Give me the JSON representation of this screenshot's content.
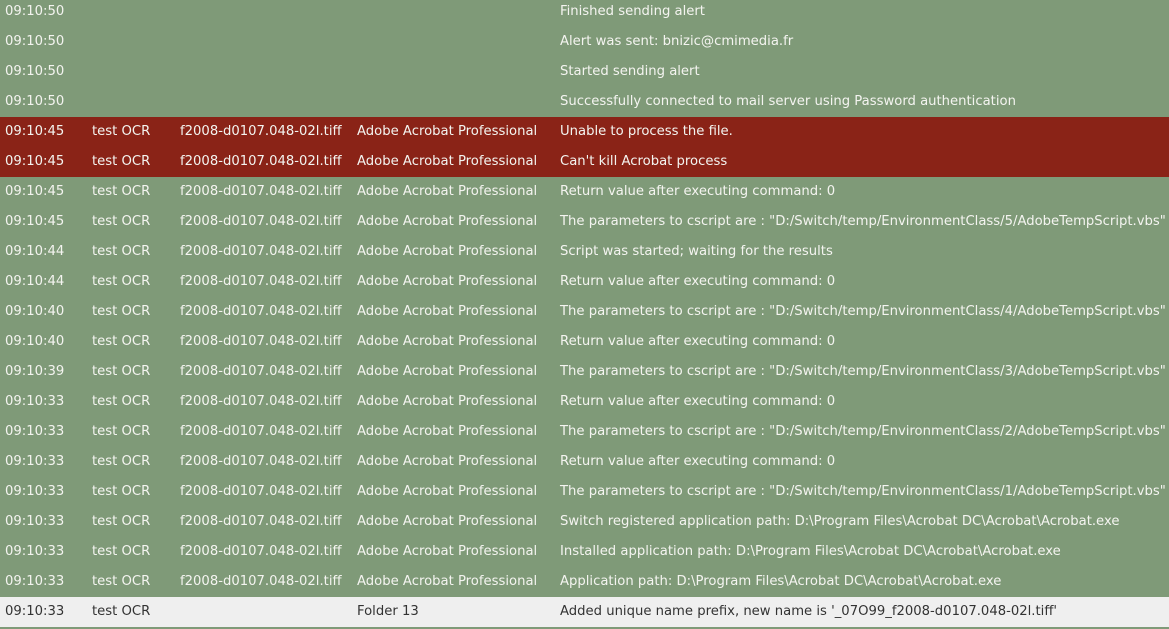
{
  "colors": {
    "info": "#7f9a78",
    "error": "#8a2317",
    "light": "#efefef"
  },
  "rows": [
    {
      "type": "info",
      "time": "09:10:50",
      "flow": "",
      "job": "",
      "element": "",
      "message": "Finished sending alert"
    },
    {
      "type": "info",
      "time": "09:10:50",
      "flow": "",
      "job": "",
      "element": "",
      "message": "Alert was sent: bnizic@cmimedia.fr"
    },
    {
      "type": "info",
      "time": "09:10:50",
      "flow": "",
      "job": "",
      "element": "",
      "message": "Started sending alert"
    },
    {
      "type": "info",
      "time": "09:10:50",
      "flow": "",
      "job": "",
      "element": "",
      "message": "Successfully connected to mail server using Password authentication"
    },
    {
      "type": "error",
      "time": "09:10:45",
      "flow": "test OCR",
      "job": "f2008-d0107.048-02l.tiff",
      "element": "Adobe Acrobat Professional",
      "message": "Unable to process the file."
    },
    {
      "type": "error",
      "time": "09:10:45",
      "flow": "test OCR",
      "job": "f2008-d0107.048-02l.tiff",
      "element": "Adobe Acrobat Professional",
      "message": "Can't kill Acrobat process"
    },
    {
      "type": "info",
      "time": "09:10:45",
      "flow": "test OCR",
      "job": "f2008-d0107.048-02l.tiff",
      "element": "Adobe Acrobat Professional",
      "message": "Return value after executing command: 0"
    },
    {
      "type": "info",
      "time": "09:10:45",
      "flow": "test OCR",
      "job": "f2008-d0107.048-02l.tiff",
      "element": "Adobe Acrobat Professional",
      "message": "The parameters to cscript are : \"D:/Switch/temp/EnvironmentClass/5/AdobeTempScript.vbs\""
    },
    {
      "type": "info",
      "time": "09:10:44",
      "flow": "test OCR",
      "job": "f2008-d0107.048-02l.tiff",
      "element": "Adobe Acrobat Professional",
      "message": "Script was started; waiting for the results"
    },
    {
      "type": "info",
      "time": "09:10:44",
      "flow": "test OCR",
      "job": "f2008-d0107.048-02l.tiff",
      "element": "Adobe Acrobat Professional",
      "message": "Return value after executing command: 0"
    },
    {
      "type": "info",
      "time": "09:10:40",
      "flow": "test OCR",
      "job": "f2008-d0107.048-02l.tiff",
      "element": "Adobe Acrobat Professional",
      "message": "The parameters to cscript are : \"D:/Switch/temp/EnvironmentClass/4/AdobeTempScript.vbs\""
    },
    {
      "type": "info",
      "time": "09:10:40",
      "flow": "test OCR",
      "job": "f2008-d0107.048-02l.tiff",
      "element": "Adobe Acrobat Professional",
      "message": "Return value after executing command: 0"
    },
    {
      "type": "info",
      "time": "09:10:39",
      "flow": "test OCR",
      "job": "f2008-d0107.048-02l.tiff",
      "element": "Adobe Acrobat Professional",
      "message": "The parameters to cscript are : \"D:/Switch/temp/EnvironmentClass/3/AdobeTempScript.vbs\""
    },
    {
      "type": "info",
      "time": "09:10:33",
      "flow": "test OCR",
      "job": "f2008-d0107.048-02l.tiff",
      "element": "Adobe Acrobat Professional",
      "message": "Return value after executing command: 0"
    },
    {
      "type": "info",
      "time": "09:10:33",
      "flow": "test OCR",
      "job": "f2008-d0107.048-02l.tiff",
      "element": "Adobe Acrobat Professional",
      "message": "The parameters to cscript are : \"D:/Switch/temp/EnvironmentClass/2/AdobeTempScript.vbs\""
    },
    {
      "type": "info",
      "time": "09:10:33",
      "flow": "test OCR",
      "job": "f2008-d0107.048-02l.tiff",
      "element": "Adobe Acrobat Professional",
      "message": "Return value after executing command: 0"
    },
    {
      "type": "info",
      "time": "09:10:33",
      "flow": "test OCR",
      "job": "f2008-d0107.048-02l.tiff",
      "element": "Adobe Acrobat Professional",
      "message": "The parameters to cscript are : \"D:/Switch/temp/EnvironmentClass/1/AdobeTempScript.vbs\""
    },
    {
      "type": "info",
      "time": "09:10:33",
      "flow": "test OCR",
      "job": "f2008-d0107.048-02l.tiff",
      "element": "Adobe Acrobat Professional",
      "message": "Switch registered application path: D:\\Program Files\\Acrobat DC\\Acrobat\\Acrobat.exe"
    },
    {
      "type": "info",
      "time": "09:10:33",
      "flow": "test OCR",
      "job": "f2008-d0107.048-02l.tiff",
      "element": "Adobe Acrobat Professional",
      "message": "Installed application path: D:\\Program Files\\Acrobat DC\\Acrobat\\Acrobat.exe"
    },
    {
      "type": "info",
      "time": "09:10:33",
      "flow": "test OCR",
      "job": "f2008-d0107.048-02l.tiff",
      "element": "Adobe Acrobat Professional",
      "message": "Application path: D:\\Program Files\\Acrobat DC\\Acrobat\\Acrobat.exe"
    },
    {
      "type": "light",
      "time": "09:10:33",
      "flow": "test OCR",
      "job": "",
      "element": "Folder 13",
      "message": "Added unique name prefix, new name is '_07O99_f2008-d0107.048-02l.tiff'"
    }
  ]
}
